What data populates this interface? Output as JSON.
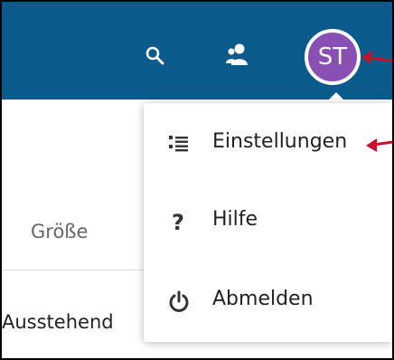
{
  "header": {
    "avatar_initials": "ST",
    "avatar_color": "#8a4fb3",
    "background_color": "#0b5a8c",
    "icons": [
      "search-icon",
      "contacts-icon"
    ]
  },
  "table": {
    "column_header": "Größe",
    "row_status": "Ausstehend"
  },
  "menu": {
    "items": [
      {
        "label": "Einstellungen",
        "icon": "settings-list-icon"
      },
      {
        "label": "Hilfe",
        "icon": "help-icon"
      },
      {
        "label": "Abmelden",
        "icon": "power-icon"
      }
    ]
  },
  "annotation_color": "#c8102e"
}
